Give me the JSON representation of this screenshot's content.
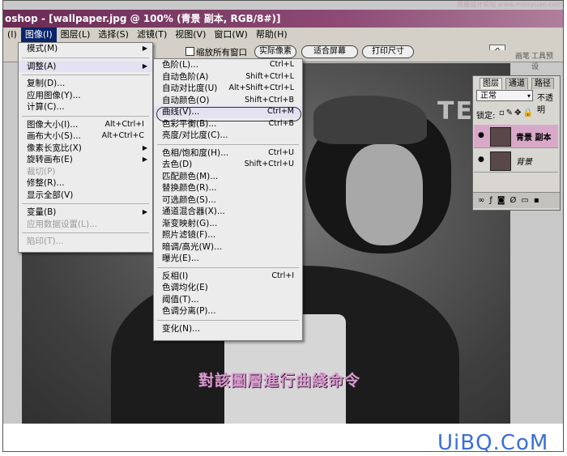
{
  "titlebar": {
    "text": "oshop - [wallpaper.jpg @ 100% (青景 副本, RGB/8#)]",
    "watermark": "思缘设计论坛 www.missyuan.com"
  },
  "menubar": {
    "items": [
      "(I)",
      "图像(I)",
      "图层(L)",
      "选择(S)",
      "滤镜(T)",
      "视图(V)",
      "窗口(W)",
      "帮助(H)"
    ]
  },
  "options": {
    "checkbox_label": "缩放所有窗口",
    "btn1": "实际像素",
    "btn2": "适合屏幕",
    "btn3": "打印尺寸"
  },
  "image_menu": {
    "items": [
      {
        "label": "模式(M)",
        "sub": true
      },
      {
        "sep": true
      },
      {
        "label": "调整(A)",
        "sub": true,
        "highlight": true
      },
      {
        "sep": true
      },
      {
        "label": "复制(D)..."
      },
      {
        "label": "应用图像(Y)..."
      },
      {
        "label": "计算(C)..."
      },
      {
        "sep": true
      },
      {
        "label": "图像大小(I)...",
        "shortcut": "Alt+Ctrl+I"
      },
      {
        "label": "画布大小(S)...",
        "shortcut": "Alt+Ctrl+C"
      },
      {
        "label": "像素长宽比(X)",
        "sub": true
      },
      {
        "label": "旋转画布(E)",
        "sub": true
      },
      {
        "label": "裁切(P)",
        "disabled": true
      },
      {
        "label": "修整(R)..."
      },
      {
        "label": "显示全部(V)"
      },
      {
        "sep": true
      },
      {
        "label": "变量(B)",
        "sub": true
      },
      {
        "label": "应用数据设置(L)...",
        "disabled": true
      },
      {
        "sep": true
      },
      {
        "label": "陷印(T)...",
        "disabled": true
      }
    ]
  },
  "adjust_menu": {
    "items": [
      {
        "label": "色阶(L)...",
        "shortcut": "Ctrl+L"
      },
      {
        "label": "自动色阶(A)",
        "shortcut": "Shift+Ctrl+L"
      },
      {
        "label": "自动对比度(U)",
        "shortcut": "Alt+Shift+Ctrl+L"
      },
      {
        "label": "自动颜色(O)",
        "shortcut": "Shift+Ctrl+B"
      },
      {
        "label": "曲线(V)...",
        "shortcut": "Ctrl+M",
        "highlight": true
      },
      {
        "label": "色彩平衡(B)...",
        "shortcut": "Ctrl+B"
      },
      {
        "label": "亮度/对比度(C)..."
      },
      {
        "sep": true
      },
      {
        "label": "色相/饱和度(H)...",
        "shortcut": "Ctrl+U"
      },
      {
        "label": "去色(D)",
        "shortcut": "Shift+Ctrl+U"
      },
      {
        "label": "匹配颜色(M)..."
      },
      {
        "label": "替换颜色(R)..."
      },
      {
        "label": "可选颜色(S)..."
      },
      {
        "label": "通道混合器(X)..."
      },
      {
        "label": "渐变映射(G)..."
      },
      {
        "label": "照片滤镜(F)..."
      },
      {
        "label": "暗调/高光(W)..."
      },
      {
        "label": "曝光(E)..."
      },
      {
        "sep": true
      },
      {
        "label": "反相(I)",
        "shortcut": "Ctrl+I"
      },
      {
        "label": "色调均化(E)"
      },
      {
        "label": "阈值(T)..."
      },
      {
        "label": "色调分离(P)..."
      },
      {
        "sep": true
      },
      {
        "label": "变化(N)..."
      }
    ]
  },
  "palette_tabs": {
    "tab1": "画笔",
    "tab2": "工具预设",
    "tab3": "图层复合"
  },
  "layers_panel": {
    "tabs": [
      "图层",
      "通道",
      "路径"
    ],
    "blend_mode": "正常",
    "opacity_label": "不透明",
    "lock_label": "锁定:",
    "layers": [
      {
        "name": "青景 副本",
        "selected": true
      },
      {
        "name": "背景"
      }
    ]
  },
  "photo": {
    "bg_text": "TE"
  },
  "caption": "對該圖層進行曲綫命令",
  "brand": "UiBQ.CoM",
  "colors": {
    "title": "#6b2b55",
    "caption": "#d89cd0",
    "brand": "#3a6fd8"
  }
}
